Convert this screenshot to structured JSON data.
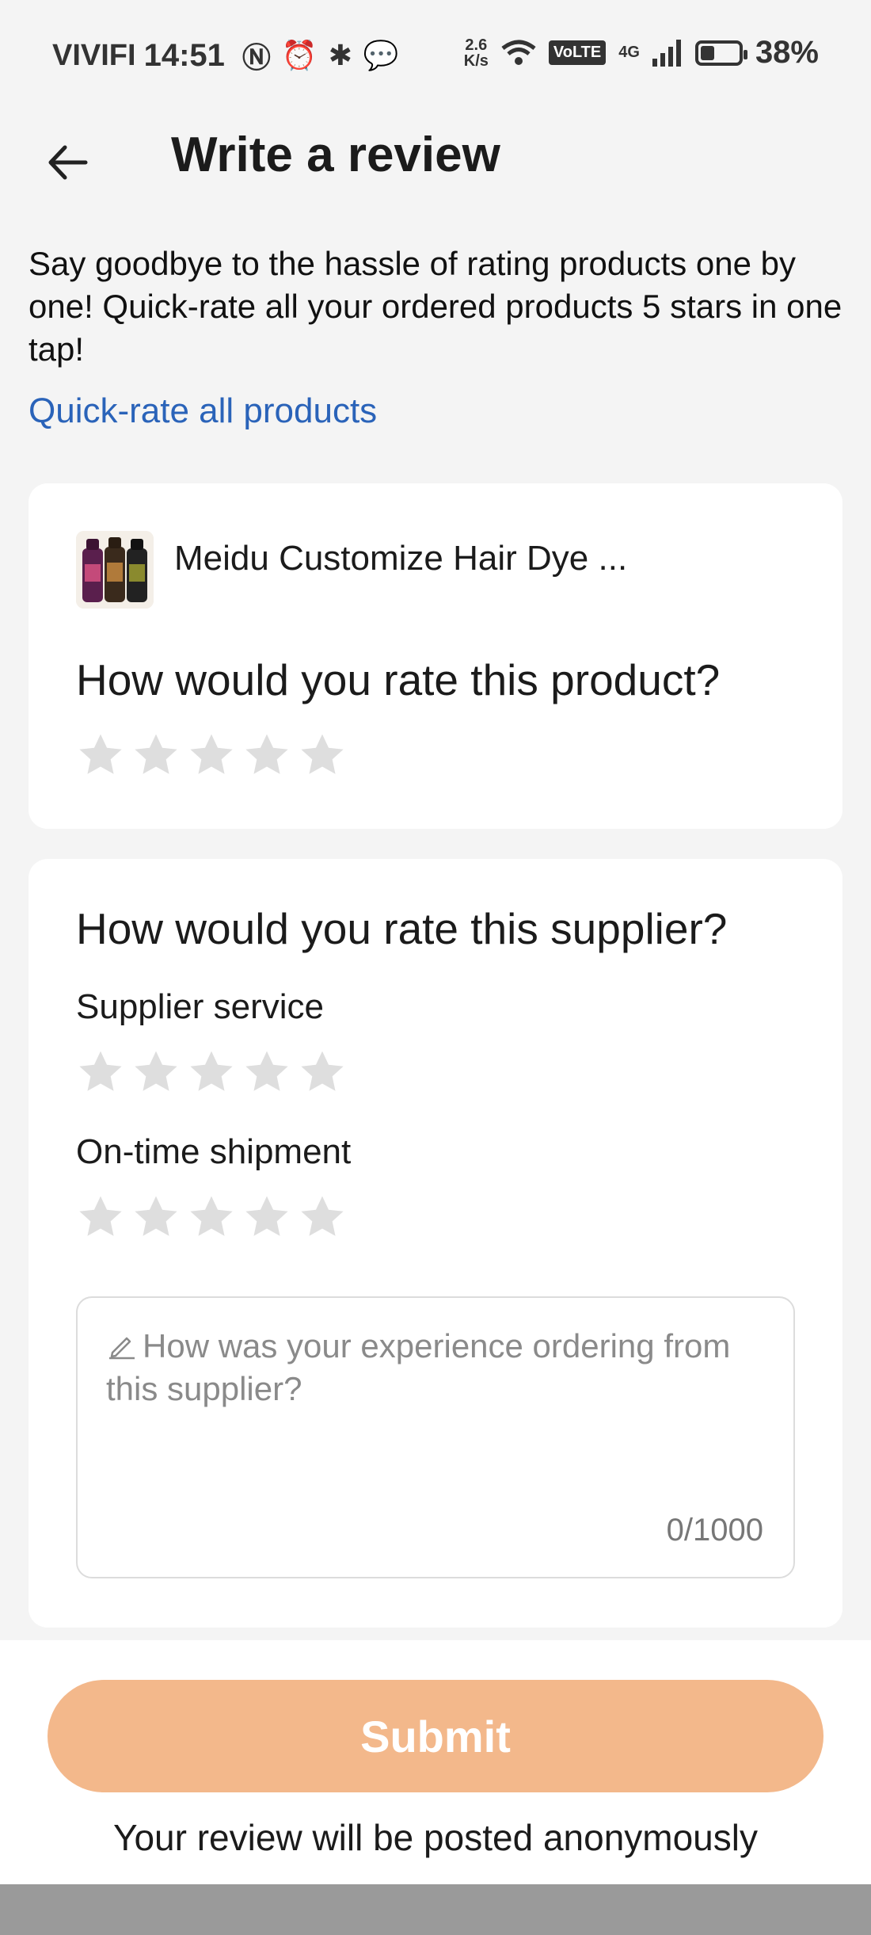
{
  "status_bar": {
    "carrier": "VIVIFI",
    "time": "14:51",
    "net_speed_top": "2.6",
    "net_speed_bottom": "K/s",
    "volte": "VoLTE",
    "network": "4G",
    "battery_percent": "38%",
    "battery_level": 0.38
  },
  "header": {
    "title": "Write a review"
  },
  "intro": {
    "text": "Say goodbye to the hassle of rating products one by one! Quick-rate all your ordered products 5 stars in one tap!",
    "quick_rate_link": "Quick-rate all products"
  },
  "product": {
    "name": "Meidu Customize Hair Dye ...",
    "question": "How would you rate this product?",
    "rating": 0,
    "max_rating": 5
  },
  "supplier": {
    "question": "How would you rate this supplier?",
    "service_label": "Supplier service",
    "service_rating": 0,
    "shipment_label": "On-time shipment",
    "shipment_rating": 0,
    "comment_placeholder": "How was your experience ordering from this supplier?",
    "counter": "0/1000"
  },
  "footer": {
    "submit_label": "Submit",
    "note": "Your review will be posted anonymously"
  },
  "colors": {
    "accent_link": "#2a63b9",
    "submit_bg": "#f3b88b",
    "star_inactive": "#dedede"
  }
}
